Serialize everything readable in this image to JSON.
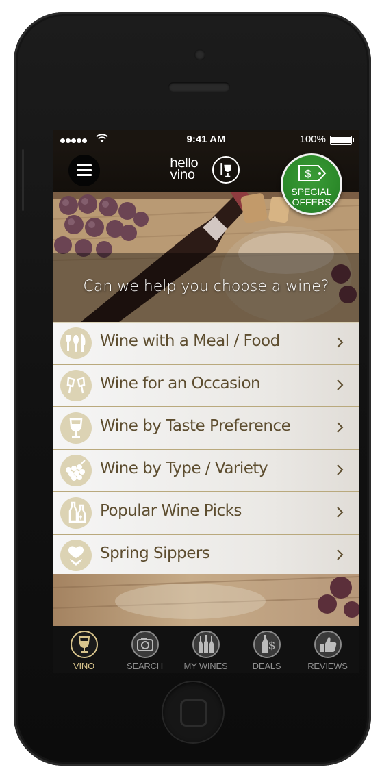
{
  "status_bar": {
    "time": "9:41 AM",
    "battery_percent": "100%"
  },
  "header": {
    "logo_line1": "hello",
    "logo_line2": "vino",
    "menu_icon": "hamburger-icon"
  },
  "special_offers": {
    "line1": "SPECIAL",
    "line2": "OFFERS",
    "color": "#2e8b2e"
  },
  "hero": {
    "prompt": "Can we help you choose a wine?"
  },
  "menu": {
    "items": [
      {
        "label": "Wine with a Meal / Food",
        "icon": "fork-knife-icon"
      },
      {
        "label": "Wine for an Occasion",
        "icon": "champagne-toast-icon"
      },
      {
        "label": "Wine by Taste Preference",
        "icon": "wine-glass-icon"
      },
      {
        "label": "Wine by Type / Variety",
        "icon": "grapes-icon"
      },
      {
        "label": "Popular Wine Picks",
        "icon": "wine-bottles-icon"
      },
      {
        "label": "Spring Sippers",
        "icon": "flower-icon"
      }
    ]
  },
  "tabs": [
    {
      "label": "VINO",
      "icon": "wine-glass-icon",
      "active": true
    },
    {
      "label": "SEARCH",
      "icon": "camera-icon",
      "active": false
    },
    {
      "label": "MY WINES",
      "icon": "bottles-icon",
      "active": false
    },
    {
      "label": "DEALS",
      "icon": "dollar-tag-icon",
      "active": false
    },
    {
      "label": "REVIEWS",
      "icon": "thumbs-up-icon",
      "active": false
    }
  ],
  "colors": {
    "accent_gold": "#d8c48c",
    "menu_text": "#5d4d2f",
    "offers_green": "#2e8b2e"
  }
}
